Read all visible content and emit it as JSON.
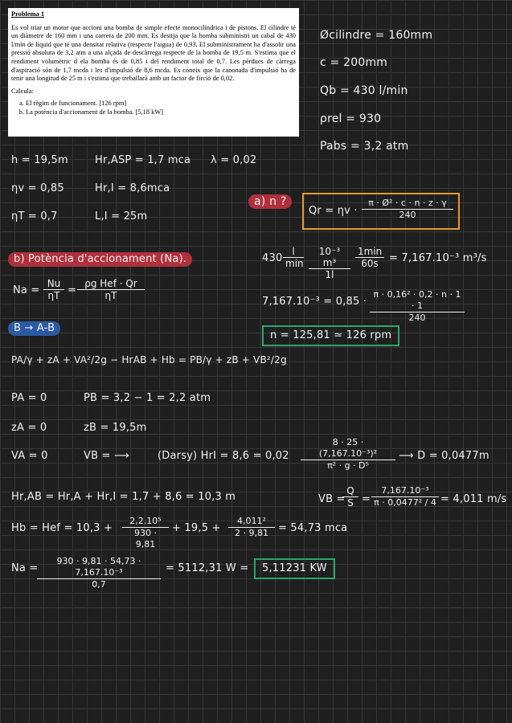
{
  "problem": {
    "title": "Problema 1",
    "statement": "Es vol triar un motor que accioni una bomba de simple efecte monocilíndrica i de pistons. El cilindre té un diàmetre de 160 mm i una carrera de 200 mm. Es desitja que la bomba subministri un cabal de 430 l/min de líquid que té una densitat relativa (respecte l'aigua) de 0,93. El subministrament ha d'assolir una pressió absoluta de 3,2 atm a una alçada de descàrrega respecte de la bomba de 19,5 m. S'estima que el rendiment volumètric d ela bomba és de 0,85 i del rendiment total de 0,7. Les pèrdues de càrrega d'aspiració són de 1,7 mcda i les d'impulsió de 8,6 mcda. Es coneix que la canonada d'impulsió ha de tenir una longitud de 25 m i s'estima que treballarà amb un factor de firció de 0,02.",
    "calc_label": "Calcula:",
    "items": [
      "El règim de funcionament. [126 rpm]",
      "La potència d'accionament de la bomba. [5,18 kW]"
    ]
  },
  "givens_right": [
    "Øcilindre = 160mm",
    "c = 200mm",
    "Qb = 430 l/min",
    "ρrel = 930",
    "Pabs = 3,2 atm"
  ],
  "givens_row1": [
    "h = 19,5m",
    "Hr,ASP = 1,7 mca",
    "λ = 0,02"
  ],
  "givens_row2": [
    "ηv = 0,85",
    "Hr,I = 8,6mca"
  ],
  "givens_row3": [
    "ηT = 0,7",
    "L,I = 25m"
  ],
  "part_a": {
    "label": "a) n ?",
    "formula_lhs": "Qr = ηv ·",
    "formula_num": "π · Ø² · c · n · z · γ",
    "formula_den": "240",
    "conv_lead": "430",
    "conv_f1_num": "l",
    "conv_f1_den": "min",
    "conv_f2_num": "10⁻³ m³",
    "conv_f2_den": "1l",
    "conv_f3_num": "1min",
    "conv_f3_den": "60s",
    "conv_result": "= 7,167.10⁻³ m³/s",
    "eq_lhs": "7,167.10⁻³ = 0,85 ·",
    "eq_num": "π · 0,16² · 0,2 · n · 1 · 1",
    "eq_den": "240",
    "result": "n = 125,81 ≃ 126 rpm"
  },
  "part_b": {
    "label": "b) Potència d'accionament (Na).",
    "na_lhs": "Na =",
    "na_f1_num": "Nu",
    "na_f1_den": "ηT",
    "na_f2_num": "ρg Hef · Qr",
    "na_f2_den": "ηT",
    "bernoulli_label": "B → A-B",
    "bernoulli": "PA/γ + zA + VA²/2g − HrAB + Hb = PB/γ + zB + VB²/2g",
    "pa": "PA = 0",
    "pb": "PB = 3,2 − 1 = 2,2 atm",
    "za": "zA = 0",
    "zb": "zB = 19,5m",
    "va": "VA = 0",
    "vb": "VB = ⟶",
    "darcy_lead": "(Darsy)  HrI = 8,6 = 0,02",
    "darcy_num": "8 · 25 · (7,167.10⁻³)²",
    "darcy_den": "π² · g · D⁵",
    "darcy_result": "⟶ D = 0,0477m",
    "hrab": "Hr,AB = Hr,A + Hr,I = 1,7 + 8,6 = 10,3 m",
    "vb_lhs": "VB =",
    "vb_f1_num": "Q",
    "vb_f1_den": "S",
    "vb_f2_num": "7,167.10⁻³",
    "vb_f2_den": "π · 0,0477² / 4",
    "vb_result": "= 4,011 m/s",
    "hb_lead": "Hb = Hef = 10,3 +",
    "hb_f1_num": "2,2.10⁵",
    "hb_f1_den": "930 · 9,81",
    "hb_mid": "+ 19,5 +",
    "hb_f2_num": "4,011²",
    "hb_f2_den": "2 · 9,81",
    "hb_result": "= 54,73 mca",
    "na_final_lhs": "Na =",
    "na_final_num": "930 · 9,81 · 54,73 · 7,167.10⁻³",
    "na_final_den": "0,7",
    "na_final_mid": "= 5112,31 W =",
    "na_final_result": "5,11231 KW"
  }
}
